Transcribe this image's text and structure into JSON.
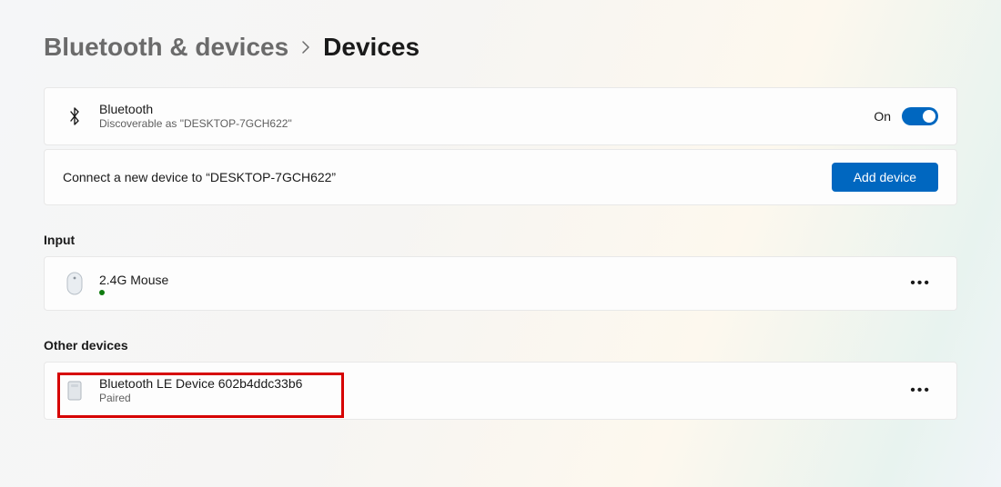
{
  "breadcrumb": {
    "parent": "Bluetooth & devices",
    "current": "Devices"
  },
  "bluetooth": {
    "title": "Bluetooth",
    "subtitle": "Discoverable as \"DESKTOP-7GCH622\"",
    "state_label": "On",
    "enabled": true
  },
  "connect": {
    "text": "Connect a new device to “DESKTOP-7GCH622”",
    "button": "Add device"
  },
  "sections": {
    "input": {
      "title": "Input",
      "device": {
        "name": "2.4G Mouse",
        "connected": true
      }
    },
    "other": {
      "title": "Other devices",
      "device": {
        "name": "Bluetooth LE Device 602b4ddc33b6",
        "status": "Paired"
      }
    }
  },
  "more_label": "•••"
}
